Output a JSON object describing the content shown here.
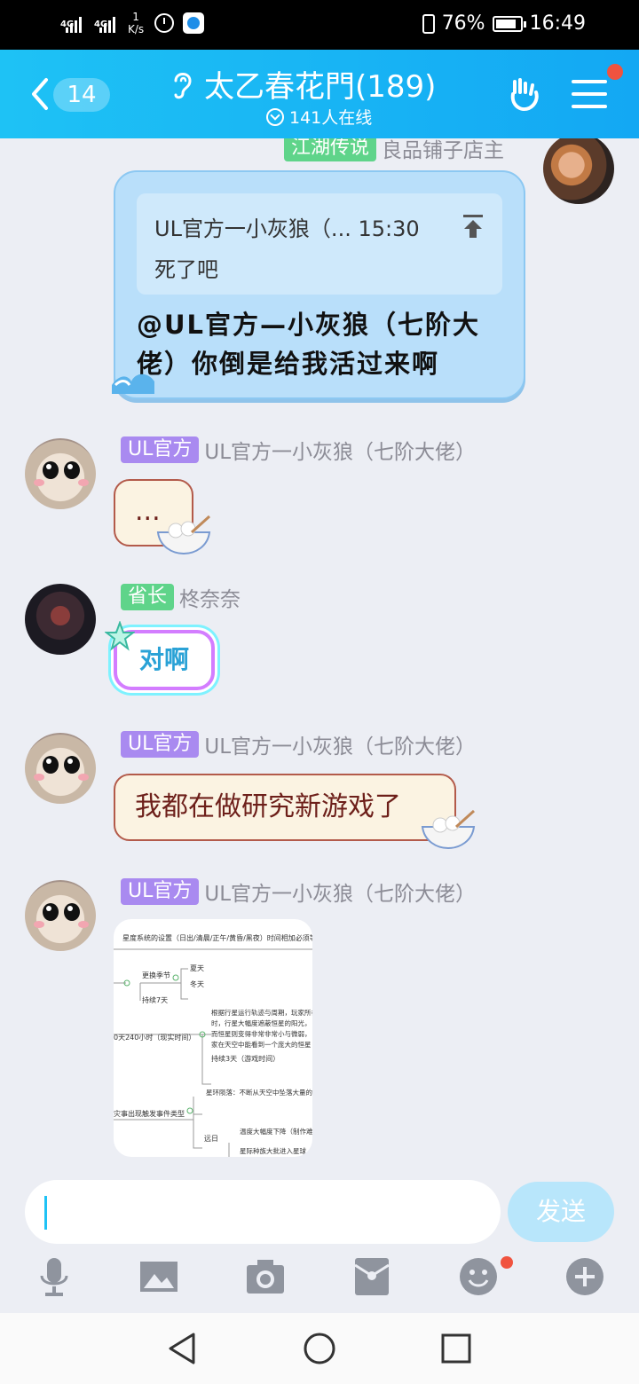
{
  "status_bar": {
    "sim1": "4G",
    "sim2": "4G",
    "net_speed_value": "1",
    "net_speed_unit": "K/s",
    "battery": "76%",
    "time": "16:49"
  },
  "header": {
    "unread_count": "14",
    "title": "太乙春花門(189)",
    "online": "141人在线"
  },
  "messages": [
    {
      "type": "self_reply",
      "partial_name": "江湖传说 良品铺子店主",
      "quote_head": "UL官方一小灰狼（... 15:30",
      "quote_text": "死了吧",
      "text": "@UL官方—小灰狼（七阶大佬）你倒是给我活过来啊"
    },
    {
      "tag": "UL官方",
      "name": "UL官方一小灰狼（七阶大佬）",
      "text": "..."
    },
    {
      "tag": "省长",
      "name": "柊奈奈",
      "text": "对啊"
    },
    {
      "tag": "UL官方",
      "name": "UL官方一小灰狼（七阶大佬）",
      "text": "我都在做研究新游戏了"
    },
    {
      "tag": "UL官方",
      "name": "UL官方一小灰狼（七阶大佬）",
      "image_lines": [
        "星度系统的设置（日出/清晨/正午/黄昏/黑夜）时间相加必须等于",
        "更换季节",
        "夏天",
        "冬天",
        "持续7天",
        "根据行星运行轨迹与周期，玩家所在",
        "时，行星大幅度遮蔽恒星的阳光，",
        "而恒星则变得非常非常小与微弱，",
        "家在天空中能看到一个庞大的恒星",
        "0天240小时（现实时间）",
        "持续3天（游戏时间）",
        "星环陨落：不断从天空中坠落大量的",
        "灾事出现触发事件类型",
        "远日",
        "温度大幅度下降（制作难",
        "星际种族大批进入星球"
      ]
    }
  ],
  "input": {
    "placeholder": "",
    "send_label": "发送"
  },
  "toolbar_icons": [
    "mic-icon",
    "image-icon",
    "camera-icon",
    "red-packet-icon",
    "emoji-icon",
    "plus-icon"
  ],
  "colors": {
    "header": "#1ec2f5",
    "tag_purple": "#a98af0",
    "tag_green": "#5fd48a",
    "self_bubble": "#b9dffa"
  }
}
